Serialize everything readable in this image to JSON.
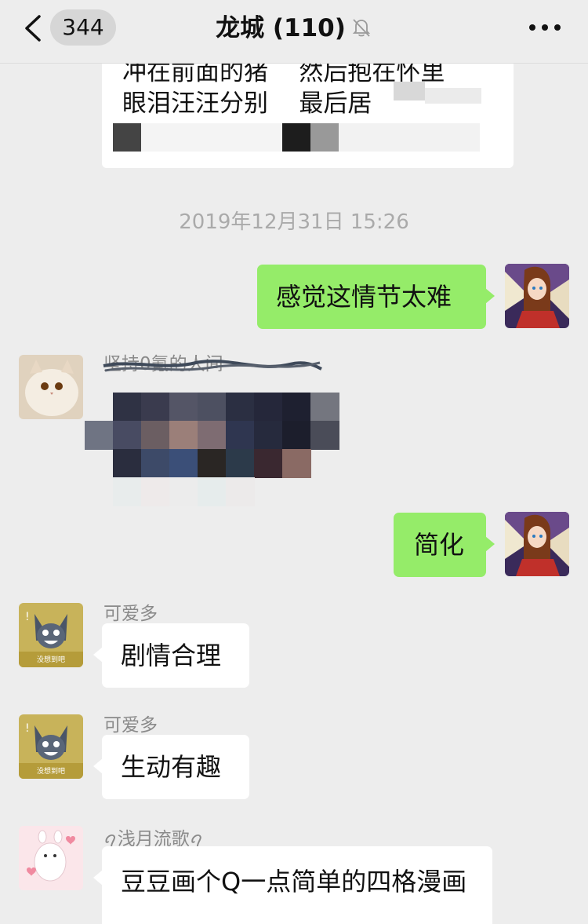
{
  "header": {
    "back_count": "344",
    "title": "龙城 (110)",
    "muted_icon": "bell-slash-icon",
    "more_icon": "more-dots-icon"
  },
  "messages": {
    "partial_card_lines": [
      "冲在前面的猪    然后抱在怀里",
      "眼泪汪汪分别    最后居"
    ],
    "timestamp": "2019年12月31日 15:26",
    "m1": {
      "side": "right",
      "text": "感觉这情节太难"
    },
    "m2": {
      "side": "left",
      "sender": "坚持0氪的人间",
      "content": "pixelated-image"
    },
    "m3": {
      "side": "right",
      "text": "简化"
    },
    "m4": {
      "side": "left",
      "sender": "可爱多",
      "text": "剧情合理",
      "avatar_caption": "没想到吧"
    },
    "m5": {
      "side": "left",
      "sender": "可爱多",
      "text": "生动有趣",
      "avatar_caption": "没想到吧"
    },
    "m6": {
      "side": "left",
      "sender": "ꪖ浅月流歌ꪖ",
      "text": "豆豆画个Q一点简单的四格漫画"
    }
  },
  "colors": {
    "background": "#ededed",
    "bubble_self": "#95ec69",
    "bubble_other": "#ffffff",
    "meta_text": "#8a8a8a"
  }
}
